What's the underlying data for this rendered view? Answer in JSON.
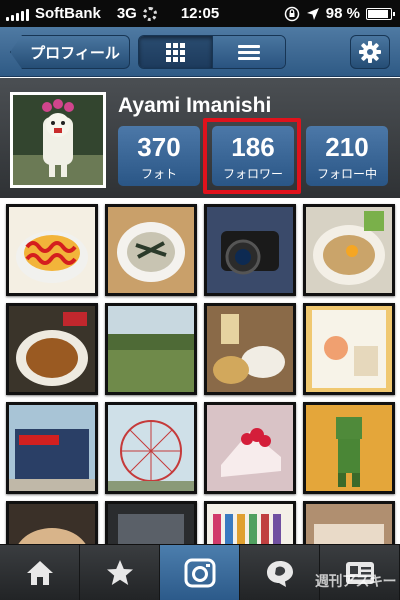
{
  "status_bar": {
    "carrier": "SoftBank",
    "network": "3G",
    "time": "12:05",
    "battery": "98 %"
  },
  "nav": {
    "back_label": "プロフィール",
    "view_modes": [
      "grid-icon",
      "list-icon"
    ],
    "active_view": "grid",
    "settings_icon": "gear-icon"
  },
  "profile": {
    "username": "Ayami Imanishi",
    "stats": [
      {
        "value": "370",
        "label": "フォト"
      },
      {
        "value": "186",
        "label": "フォロワー"
      },
      {
        "value": "210",
        "label": "フォロー中"
      }
    ],
    "highlighted_stat": "フォロワー",
    "highlight_color": "#e0121c"
  },
  "photos": [
    "omurice",
    "salad-bowl",
    "camera",
    "ramen-egg",
    "curry-rice",
    "park",
    "meal-table",
    "book-cover",
    "building",
    "ferris-wheel",
    "strawberry-cake",
    "figure",
    "ramen",
    "window",
    "magazines",
    "street"
  ],
  "tabs": [
    {
      "name": "home-icon"
    },
    {
      "name": "star-icon"
    },
    {
      "name": "camera-icon"
    },
    {
      "name": "search-icon"
    },
    {
      "name": "profile-icon"
    }
  ],
  "active_tab": 2,
  "watermark": "週刊アスキー",
  "colors": {
    "nav_blue": "#2f5a85",
    "stat_blue": "#2a5686",
    "header_gray": "#3a3d40"
  }
}
